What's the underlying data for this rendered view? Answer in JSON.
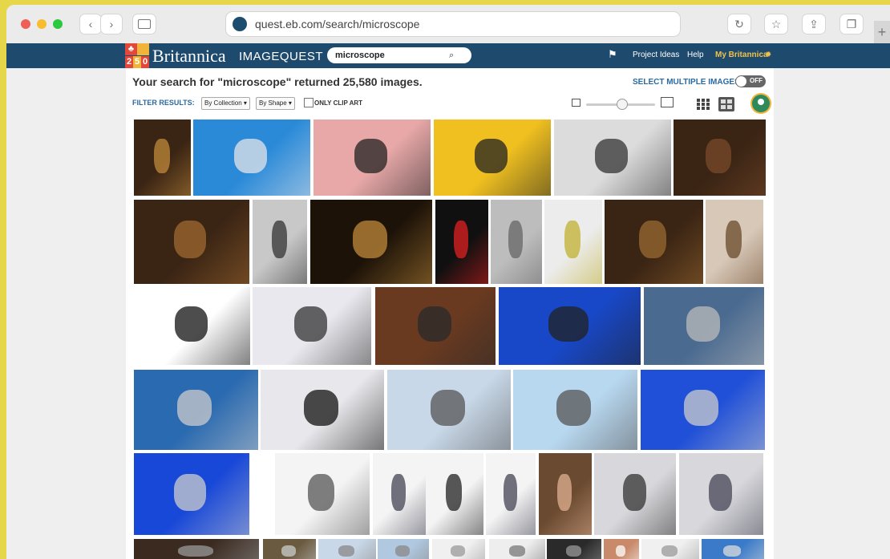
{
  "browser": {
    "url": "quest.eb.com/search/microscope"
  },
  "header": {
    "badge_top": "2",
    "badge_digits": [
      "2",
      "5",
      "0"
    ],
    "brand": "Britannica",
    "product": "IMAGEQUEST",
    "search_value": "microscope",
    "links": [
      "Project Ideas",
      "Help",
      "My Britannica"
    ]
  },
  "results": {
    "prefix": "Your search for \"",
    "term": "microscope",
    "suffix": "\" returned 25,580 images.",
    "select_multiple": "SELECT MULTIPLE IMAGES",
    "toggle": "OFF"
  },
  "filters": {
    "label": "FILTER RESULTS:",
    "collection": "By Collection ▾",
    "shape": "By Shape ▾",
    "clip_art": "ONLY CLIP ART"
  },
  "colors": {
    "nav": "#1e4a6e",
    "accent": "#2a6aa0"
  }
}
